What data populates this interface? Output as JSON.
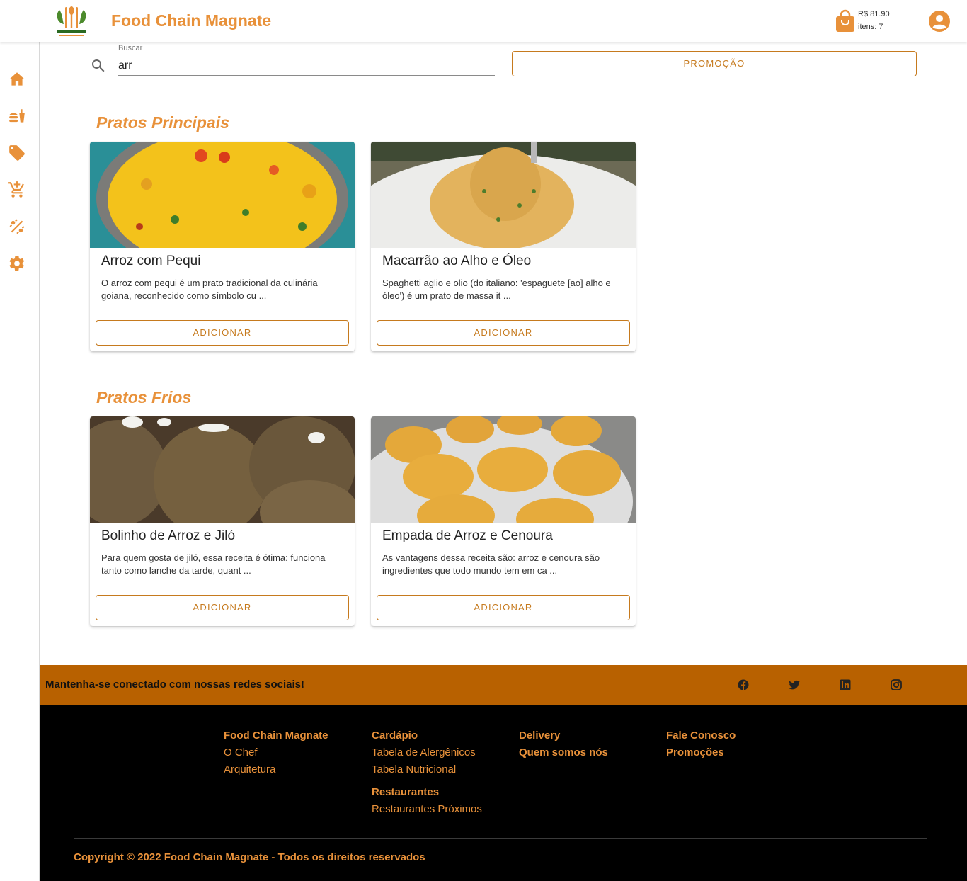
{
  "header": {
    "logo_alt": "YOUR RESTAURANT",
    "title": "Food Chain Magnate",
    "cart_total": "R$ 81.90",
    "cart_items": "itens: 7",
    "icons": {
      "cart": "shopping-bag-icon",
      "account": "account-circle-icon"
    }
  },
  "sidebar": {
    "items": [
      {
        "name": "home-icon"
      },
      {
        "name": "fastfood-icon"
      },
      {
        "name": "tag-icon"
      },
      {
        "name": "cart-add-icon"
      },
      {
        "name": "promo-percent-icon"
      },
      {
        "name": "settings-icon"
      }
    ]
  },
  "search": {
    "label": "Buscar",
    "value": "arr"
  },
  "promo_button": "PROMOÇÃO",
  "sections": [
    {
      "title": "Pratos Principais",
      "cards": [
        {
          "title": "Arroz com Pequi",
          "description": "O arroz com pequi é um prato tradicional da culinária goiana, reconhecido como símbolo cu ...",
          "button": "ADICIONAR"
        },
        {
          "title": "Macarrão ao Alho e Óleo",
          "description": "Spaghetti aglio e olio (do italiano: 'espaguete [ao] alho e óleo') é um prato de massa it ...",
          "button": "ADICIONAR"
        }
      ]
    },
    {
      "title": "Pratos Frios",
      "cards": [
        {
          "title": "Bolinho de Arroz e Jiló",
          "description": "Para quem gosta de jiló, essa receita é ótima: funciona tanto como lanche da tarde, quant ...",
          "button": "ADICIONAR"
        },
        {
          "title": "Empada de Arroz e Cenoura",
          "description": "As vantagens dessa receita são: arroz e cenoura são ingredientes que todo mundo tem em ca ...",
          "button": "ADICIONAR"
        }
      ]
    }
  ],
  "social": {
    "text": "Mantenha-se conectado com nossas redes sociais!",
    "icons": [
      "facebook-icon",
      "twitter-icon",
      "linkedin-icon",
      "instagram-icon"
    ]
  },
  "footer": {
    "col1": {
      "head": "Food Chain Magnate",
      "links": [
        "O Chef",
        "Arquitetura"
      ]
    },
    "col2": {
      "head": "Cardápio",
      "links": [
        "Tabela de Alergênicos",
        "Tabela Nutricional"
      ],
      "head2": "Restaurantes",
      "links2": [
        "Restaurantes Próximos"
      ]
    },
    "col3": {
      "heads": [
        "Delivery",
        "Quem somos nós"
      ]
    },
    "col4": {
      "heads": [
        "Fale Conosco",
        "Promoções"
      ]
    },
    "copyright": "Copyright © 2022 Food Chain Magnate - Todos os direitos reservados"
  },
  "colors": {
    "accent": "#e8913a",
    "button_border": "#c67a1e",
    "social_bar": "#b86100",
    "footer_bg": "#000000"
  }
}
